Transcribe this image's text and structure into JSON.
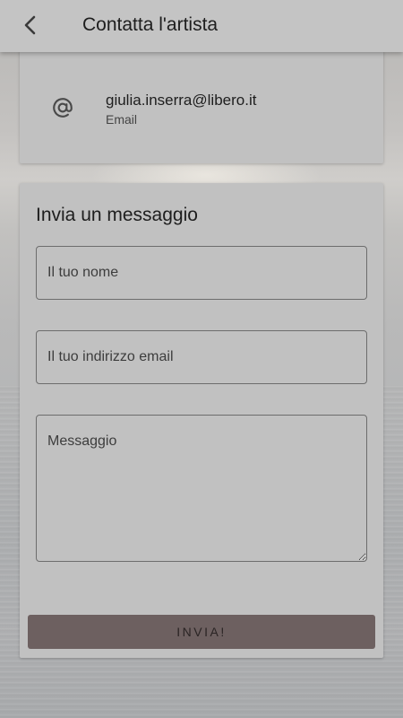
{
  "header": {
    "title": "Contatta l'artista",
    "back_icon": "chevron-left-icon"
  },
  "contact": {
    "icon": "at-sign-icon",
    "email": "giulia.inserra@libero.it",
    "email_label": "Email"
  },
  "form": {
    "title": "Invia un messaggio",
    "name_placeholder": "Il tuo nome",
    "email_placeholder": "Il tuo indirizzo email",
    "message_placeholder": "Messaggio",
    "submit_label": "INVIA!"
  },
  "colors": {
    "appbar": "#c4c4c4",
    "card": "#c1c1c1",
    "button": "#6d6060"
  }
}
